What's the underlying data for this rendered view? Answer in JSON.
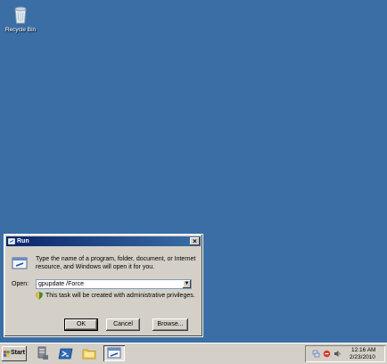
{
  "desktop": {
    "icons": [
      {
        "label": "Recycle Bin",
        "icon": "recycle-bin-icon"
      }
    ],
    "background_color": "#3a6ea5"
  },
  "run_dialog": {
    "title": "Run",
    "description": "Type the name of a program, folder, document, or Internet resource, and Windows will open it for you.",
    "open_label": "Open:",
    "open_value": "gpupdate /Force",
    "admin_note": "This task will be created with administrative privileges.",
    "buttons": {
      "ok": "OK",
      "cancel": "Cancel",
      "browse": "Browse..."
    },
    "close_glyph": "×"
  },
  "taskbar": {
    "start_label": "Start",
    "quick_launch": [
      {
        "icon": "server-manager-icon"
      },
      {
        "icon": "powershell-icon"
      },
      {
        "icon": "explorer-folder-icon"
      },
      {
        "icon": "run-app-icon",
        "active": true
      }
    ],
    "tray_icons": [
      "network-icon",
      "security-icon",
      "speaker-icon"
    ],
    "clock": {
      "time": "12:16 AM",
      "date": "2/23/2010"
    }
  }
}
